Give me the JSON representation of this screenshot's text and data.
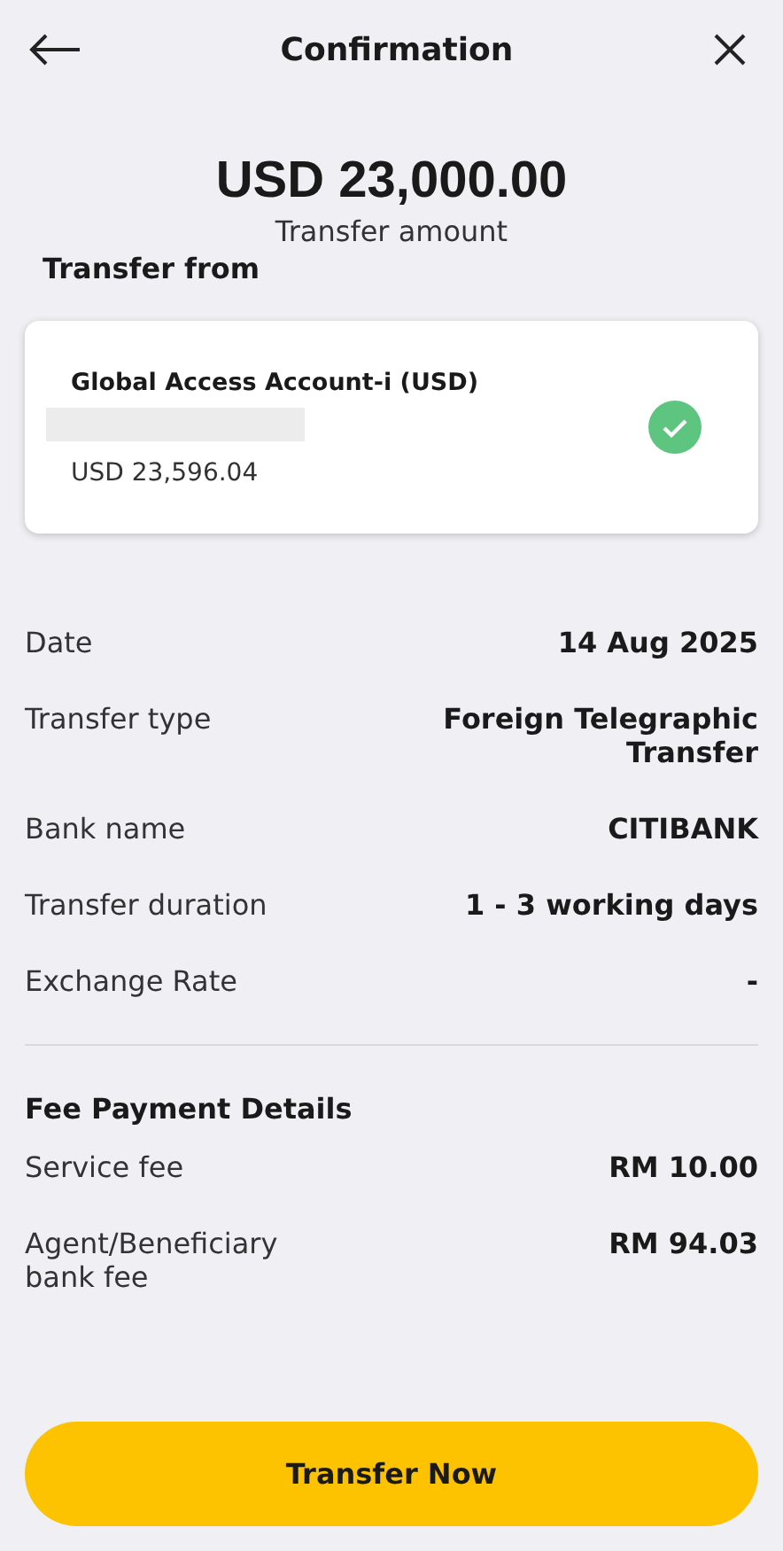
{
  "header": {
    "title": "Confirmation"
  },
  "amount": {
    "value": "USD 23,000.00",
    "caption": "Transfer amount"
  },
  "transfer_from": {
    "heading": "Transfer from",
    "account": {
      "name": "Global Access Account-i (USD)",
      "balance": "USD 23,596.04",
      "selected": true
    }
  },
  "details": [
    {
      "label": "Date",
      "value": "14 Aug 2025"
    },
    {
      "label": "Transfer type",
      "value": "Foreign Telegraphic Transfer"
    },
    {
      "label": "Bank name",
      "value": "CITIBANK"
    },
    {
      "label": "Transfer duration",
      "value": "1 - 3 working days"
    },
    {
      "label": "Exchange Rate",
      "value": "-"
    }
  ],
  "fees": {
    "heading": "Fee Payment Details",
    "rows": [
      {
        "label": "Service fee",
        "value": "RM 10.00"
      },
      {
        "label": "Agent/Beneficiary bank fee",
        "value": "RM 94.03"
      }
    ]
  },
  "button": {
    "label": "Transfer Now"
  }
}
